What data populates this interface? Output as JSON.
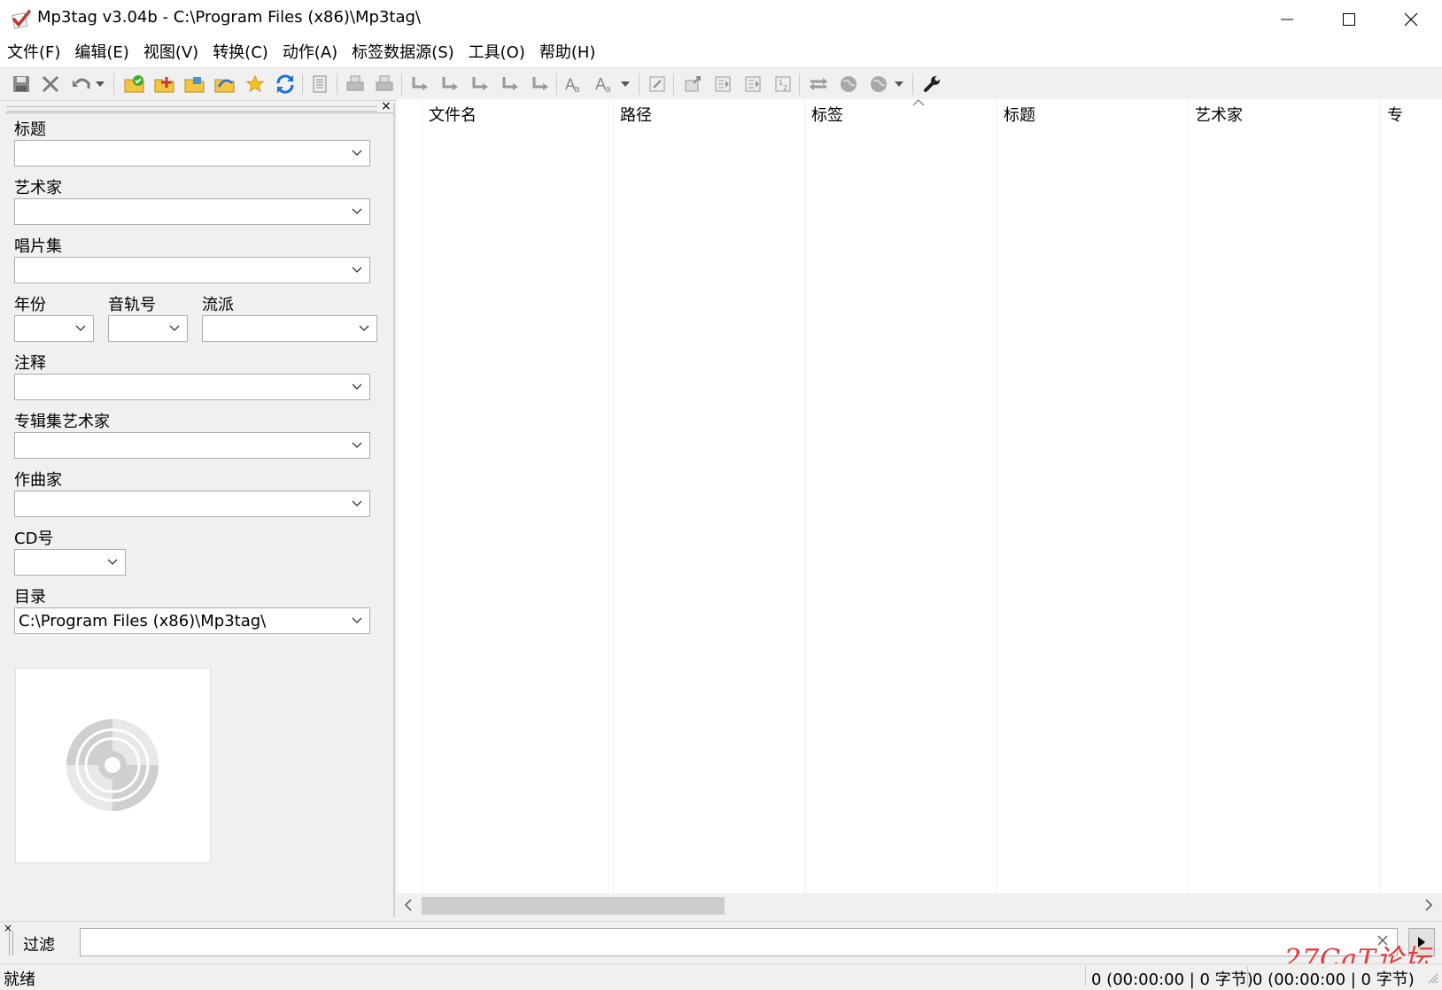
{
  "window": {
    "title": "Mp3tag v3.04b  -  C:\\Program Files (x86)\\Mp3tag\\"
  },
  "menu": [
    {
      "label": "文件(F)"
    },
    {
      "label": "编辑(E)"
    },
    {
      "label": "视图(V)"
    },
    {
      "label": "转换(C)"
    },
    {
      "label": "动作(A)"
    },
    {
      "label": "标签数据源(S)"
    },
    {
      "label": "工具(O)"
    },
    {
      "label": "帮助(H)"
    }
  ],
  "tag_panel": {
    "title_label": "标题",
    "artist_label": "艺术家",
    "album_label": "唱片集",
    "year_label": "年份",
    "track_label": "音轨号",
    "genre_label": "流派",
    "comment_label": "注释",
    "album_artist_label": "专辑集艺术家",
    "composer_label": "作曲家",
    "disc_label": "CD号",
    "directory_label": "目录",
    "directory_value": "C:\\Program Files (x86)\\Mp3tag\\"
  },
  "file_list": {
    "columns": [
      "文件名",
      "路径",
      "标签",
      "标题",
      "艺术家",
      "专"
    ]
  },
  "filter": {
    "label": "过滤",
    "value": ""
  },
  "status": {
    "left": "就绪",
    "selected": "0 (00:00:00 | 0 字节)",
    "total": "0 (00:00:00 | 0 字节)"
  },
  "watermark": "27CaT论坛",
  "colors": {
    "accent_green": "#3fae29",
    "folder_yellow": "#f5c542",
    "refresh_blue": "#1e6fd9",
    "watermark_red": "#e8383d"
  }
}
